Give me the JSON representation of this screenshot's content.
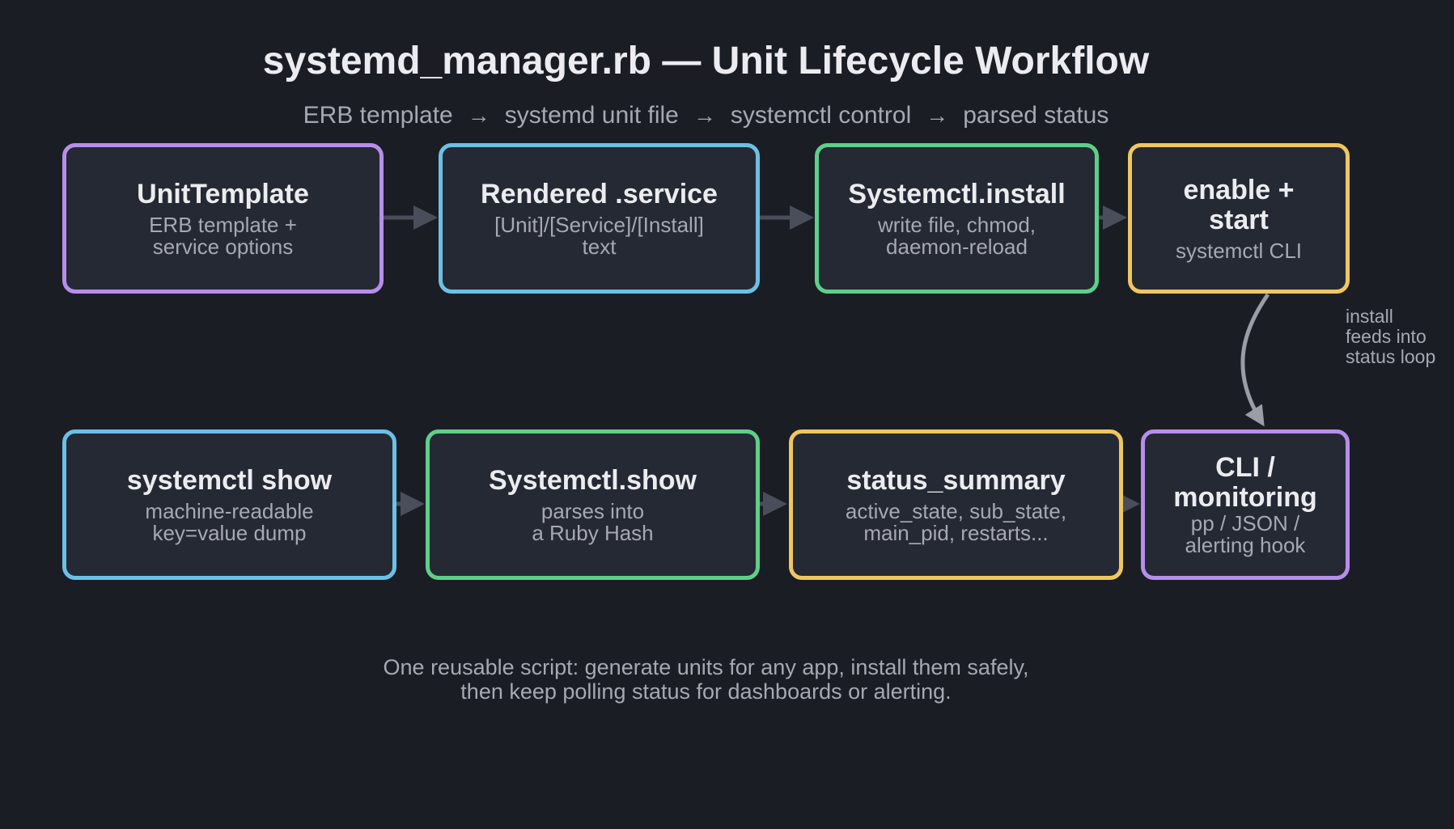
{
  "title": "systemd_manager.rb — Unit Lifecycle Workflow",
  "pipeline": [
    "ERB template",
    "systemd unit file",
    "systemctl control",
    "parsed status"
  ],
  "arrow_glyph": "→",
  "nodes": {
    "unit_template": {
      "title": "UnitTemplate",
      "subtitle": "ERB template +\nservice options"
    },
    "rendered_service": {
      "title": "Rendered .service",
      "subtitle": "[Unit]/[Service]/[Install]\ntext"
    },
    "systemctl_install": {
      "title": "Systemctl.install",
      "subtitle": "write file, chmod,\ndaemon-reload"
    },
    "enable_start": {
      "title": "enable +\nstart",
      "subtitle": "systemctl CLI"
    },
    "systemctl_show_cmd": {
      "title": "systemctl show",
      "subtitle": "machine-readable\nkey=value dump"
    },
    "systemctl_show_parse": {
      "title": "Systemctl.show",
      "subtitle": "parses into\na Ruby Hash"
    },
    "status_summary": {
      "title": "status_summary",
      "subtitle": "active_state, sub_state,\nmain_pid, restarts..."
    },
    "cli_monitoring": {
      "title": "CLI /\nmonitoring",
      "subtitle": "pp / JSON /\nalerting hook"
    }
  },
  "side_note": "install\nfeeds into\nstatus loop",
  "footer": "One reusable script: generate units for any app, install them safely,\nthen keep polling status for dashboards or alerting.",
  "colors": {
    "background": "#1b1d25",
    "node_fill": "#252934",
    "purple": "#b78eea",
    "blue": "#6cc0e6",
    "green": "#5ecf8a",
    "yellow": "#eec760",
    "connector": "#4a4e5a",
    "loop_arrow": "#9a9ca6"
  }
}
